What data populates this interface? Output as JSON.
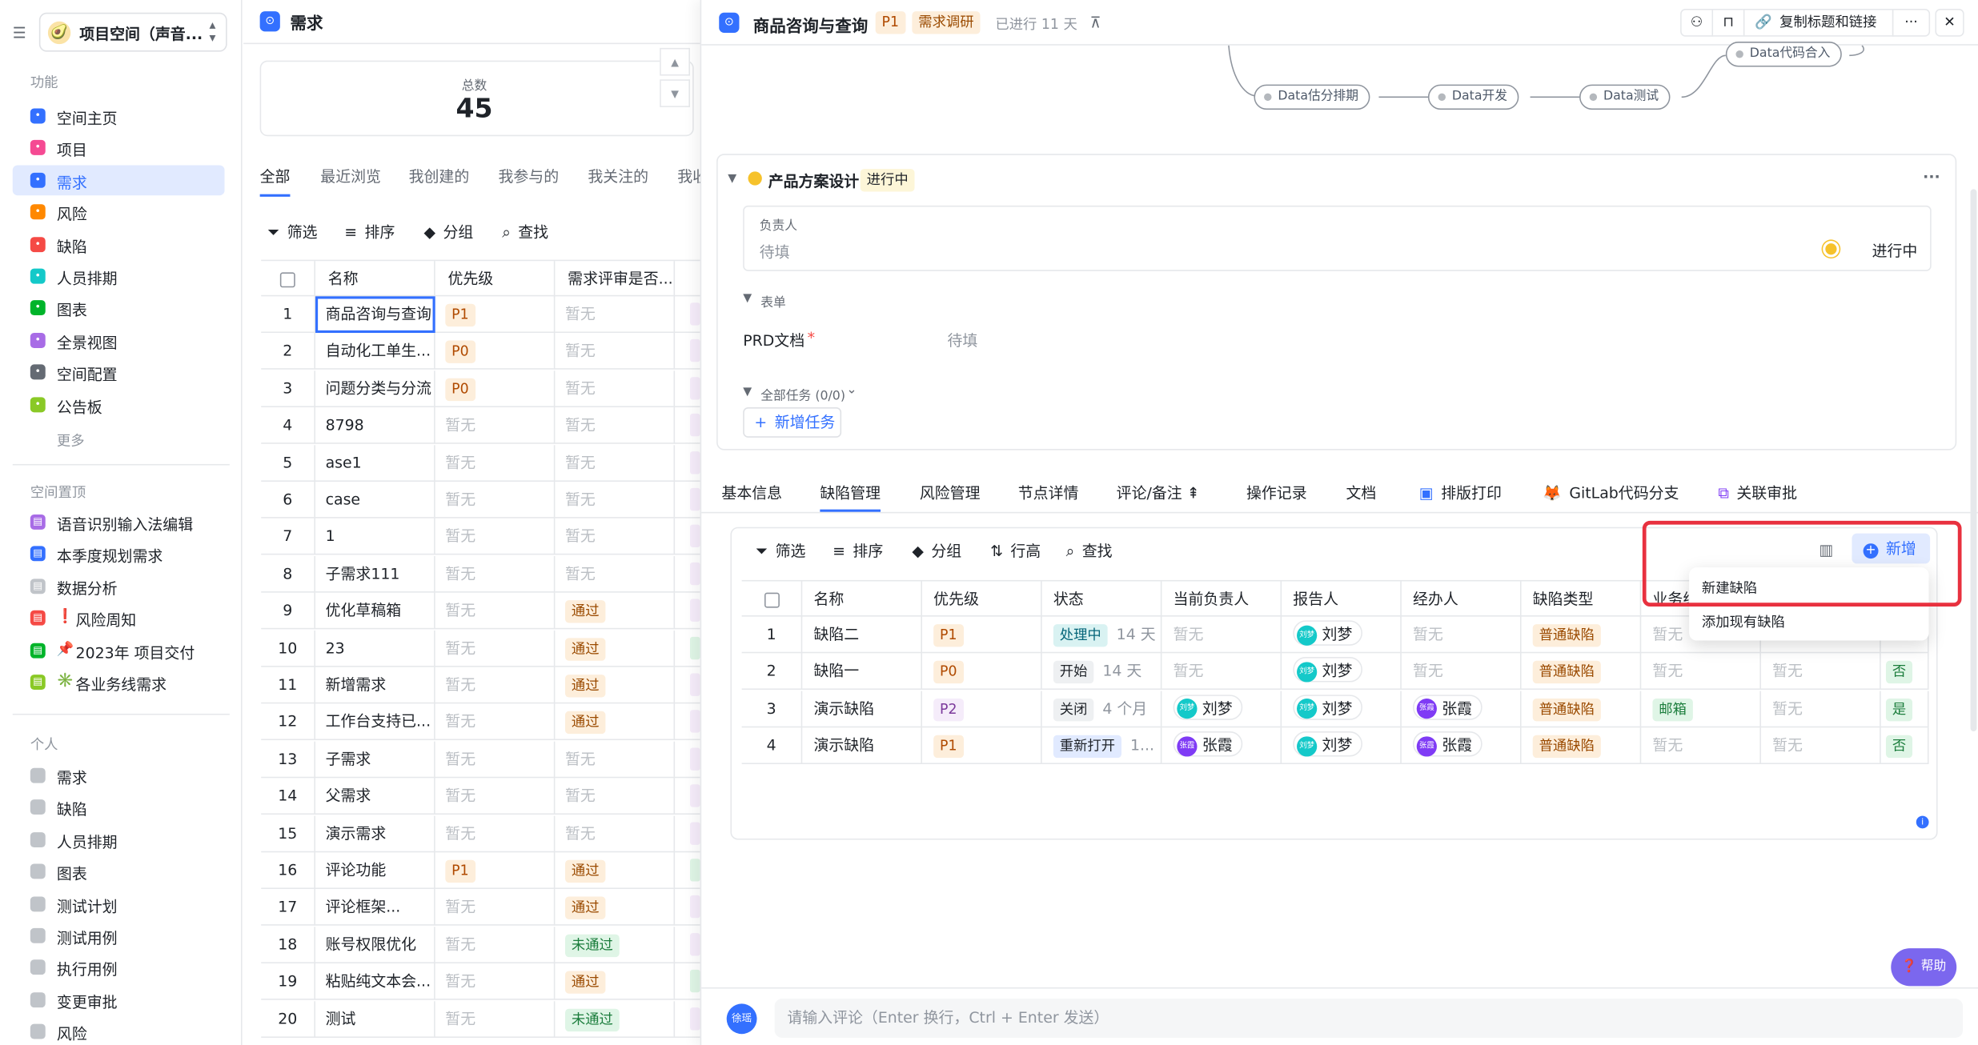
{
  "sidebar": {
    "collapse_glyph": "☰",
    "space_name": "项目空间（声音...",
    "space_avatar": "🥑",
    "sections": {
      "features": "功能",
      "pinned": "空间置顶",
      "personal": "个人"
    },
    "features": [
      {
        "label": "空间主页",
        "icon": "home-icon",
        "color": "#3370ff"
      },
      {
        "label": "项目",
        "icon": "project-icon",
        "color": "#f54a93"
      },
      {
        "label": "需求",
        "icon": "requirement-icon",
        "color": "#3370ff",
        "active": true
      },
      {
        "label": "风险",
        "icon": "risk-icon",
        "color": "#ff8800"
      },
      {
        "label": "缺陷",
        "icon": "bug-icon",
        "color": "#f54a45"
      },
      {
        "label": "人员排期",
        "icon": "schedule-icon",
        "color": "#14c9c9"
      },
      {
        "label": "图表",
        "icon": "chart-icon",
        "color": "#00b42a"
      },
      {
        "label": "全景视图",
        "icon": "panorama-icon",
        "color": "#a86ce6"
      },
      {
        "label": "空间配置",
        "icon": "config-icon",
        "color": "#646a73"
      },
      {
        "label": "公告板",
        "icon": "board-icon",
        "color": "#8ac926"
      }
    ],
    "more": "更多",
    "pinned": [
      {
        "label": "语音识别输入法编辑",
        "icon": "requirement-view-icon",
        "color": "#a86ce6"
      },
      {
        "label": "本季度规划需求",
        "icon": "list-view-icon",
        "color": "#3370ff"
      },
      {
        "label": "数据分析",
        "icon": "folder-icon",
        "color": "#c0c4c9"
      },
      {
        "label": "风险周知",
        "emoji": "❗",
        "icon": "risk-view-icon",
        "color": "#f54a45"
      },
      {
        "label": "2023年 项目交付",
        "emoji": "📌",
        "icon": "project-view-icon",
        "color": "#00b42a"
      },
      {
        "label": "各业务线需求",
        "emoji": "✳️",
        "icon": "business-view-icon",
        "color": "#8ac926"
      }
    ],
    "personal": [
      "需求",
      "缺陷",
      "人员排期",
      "图表",
      "测试计划",
      "测试用例",
      "执行用例",
      "变更审批",
      "风险"
    ]
  },
  "list": {
    "title": "需求",
    "total_label": "总数",
    "total_value": "45",
    "tabs": [
      "全部",
      "最近浏览",
      "我创建的",
      "我参与的",
      "我关注的",
      "我收"
    ],
    "toolbar": [
      "筛选",
      "排序",
      "分组",
      "查找"
    ],
    "columns": [
      "名称",
      "优先级",
      "需求评审是否..."
    ],
    "rows": [
      {
        "n": "1",
        "name": "商品咨询与查询",
        "pri": "P1",
        "review": "暂无"
      },
      {
        "n": "2",
        "name": "自动化工单生...",
        "pri": "P0",
        "review": "暂无"
      },
      {
        "n": "3",
        "name": "问题分类与分流",
        "pri": "P0",
        "review": "暂无"
      },
      {
        "n": "4",
        "name": "8798",
        "pri": "暂无",
        "review": "暂无"
      },
      {
        "n": "5",
        "name": "ase1",
        "pri": "暂无",
        "review": "暂无"
      },
      {
        "n": "6",
        "name": "case",
        "pri": "暂无",
        "review": "暂无"
      },
      {
        "n": "7",
        "name": "1",
        "pri": "暂无",
        "review": "暂无"
      },
      {
        "n": "8",
        "name": "子需求111",
        "pri": "暂无",
        "review": "暂无"
      },
      {
        "n": "9",
        "name": "优化草稿箱",
        "pri": "暂无",
        "review": "通过"
      },
      {
        "n": "10",
        "name": "23",
        "pri": "暂无",
        "review": "通过"
      },
      {
        "n": "11",
        "name": "新增需求",
        "pri": "暂无",
        "review": "通过"
      },
      {
        "n": "12",
        "name": "工作台支持已...",
        "pri": "暂无",
        "review": "通过"
      },
      {
        "n": "13",
        "name": "子需求",
        "pri": "暂无",
        "review": "暂无"
      },
      {
        "n": "14",
        "name": "父需求",
        "pri": "暂无",
        "review": "暂无"
      },
      {
        "n": "15",
        "name": "演示需求",
        "pri": "暂无",
        "review": "暂无"
      },
      {
        "n": "16",
        "name": "评论功能",
        "pri": "P1",
        "review": "通过"
      },
      {
        "n": "17",
        "name": "评论框架...",
        "pri": "暂无",
        "review": "通过"
      },
      {
        "n": "18",
        "name": "账号权限优化",
        "pri": "暂无",
        "review": "未通过"
      },
      {
        "n": "19",
        "name": "粘贴纯文本会...",
        "pri": "暂无",
        "review": "通过"
      },
      {
        "n": "20",
        "name": "测试",
        "pri": "暂无",
        "review": "未通过"
      }
    ]
  },
  "detail": {
    "title": "商品咨询与查询",
    "priority": "P1",
    "stage": "需求调研",
    "elapsed": "已进行 11 天",
    "copy_button": "复制标题和链接",
    "more_glyph": "···",
    "close_glyph": "✕",
    "flow_nodes": [
      "Data估分排期",
      "Data开发",
      "Data测试",
      "Data代码合入"
    ],
    "node": {
      "title": "产品方案设计",
      "status": "进行中",
      "owner_label": "负责人",
      "owner_value": "待填",
      "owner_status": "进行中",
      "form_label": "表单",
      "prd_label": "PRD文档",
      "prd_required": "*",
      "prd_value": "待填",
      "tasks_label": "全部任务 (0/0)",
      "add_task": "新增任务"
    },
    "tabs": [
      "基本信息",
      "缺陷管理",
      "风险管理",
      "节点详情",
      "评论/备注",
      "操作记录",
      "文档",
      "排版打印",
      "GitLab代码分支",
      "关联审批"
    ],
    "bug_toolbar": [
      "筛选",
      "排序",
      "分组",
      "行高",
      "查找"
    ],
    "add_button": "新增",
    "dropdown": [
      "新建缺陷",
      "添加现有缺陷"
    ],
    "bug_columns": [
      "名称",
      "优先级",
      "状态",
      "当前负责人",
      "报告人",
      "经办人",
      "缺陷类型",
      "业务线",
      "",
      ""
    ],
    "bugs": [
      {
        "n": "1",
        "name": "缺陷二",
        "pri": "P1",
        "status": "处理中",
        "dur": "14 天",
        "owner": "暂无",
        "reporter": "刘梦",
        "handler": "暂无",
        "type": "普通缺陷",
        "line": "暂无",
        "c9": "",
        "flag": ""
      },
      {
        "n": "2",
        "name": "缺陷一",
        "pri": "P0",
        "status": "开始",
        "dur": "14 天",
        "owner": "暂无",
        "reporter": "刘梦",
        "handler": "暂无",
        "type": "普通缺陷",
        "line": "暂无",
        "c9": "暂无",
        "flag": "否"
      },
      {
        "n": "3",
        "name": "演示缺陷",
        "pri": "P2",
        "status": "关闭",
        "dur": "4 个月",
        "owner": "刘梦",
        "reporter": "刘梦",
        "handler": "张霞",
        "type": "普通缺陷",
        "line": "邮箱",
        "c9": "暂无",
        "flag": "是"
      },
      {
        "n": "4",
        "name": "演示缺陷",
        "pri": "P1",
        "status": "重新打开",
        "dur": "1...",
        "owner": "张霞",
        "reporter": "刘梦",
        "handler": "张霞",
        "type": "普通缺陷",
        "line": "暂无",
        "c9": "暂无",
        "flag": "否"
      }
    ],
    "comment_placeholder": "请输入评论（Enter 换行，Ctrl + Enter 发送）",
    "comment_avatar": "徐瑶",
    "help": "帮助"
  }
}
